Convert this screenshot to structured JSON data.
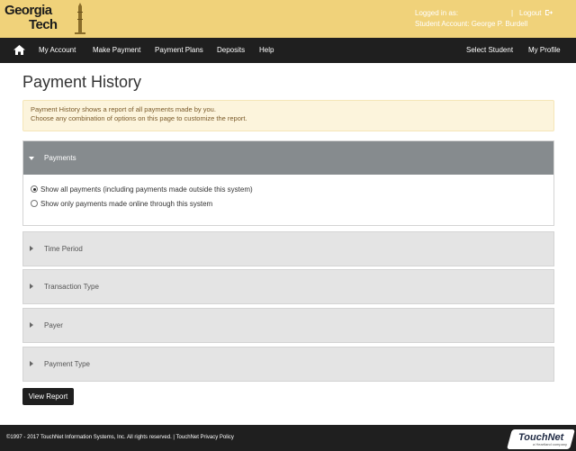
{
  "header": {
    "logo_line1": "Georgia",
    "logo_line2": "Tech",
    "logged_in_label": "Logged in as:",
    "separator": "|",
    "logout_label": "Logout",
    "student_account": "Student Account: George P. Burdell"
  },
  "nav": {
    "items": [
      "My Account",
      "Make Payment",
      "Payment Plans",
      "Deposits",
      "Help"
    ],
    "right_items": [
      "Select Student",
      "My Profile"
    ]
  },
  "page": {
    "title": "Payment History",
    "notice_line1": "Payment History shows a report of all payments made by you.",
    "notice_line2": "Choose any combination of options on this page to customize the report."
  },
  "sections": {
    "payments": {
      "label": "Payments",
      "options": [
        {
          "label": "Show all payments (including payments made outside this system)",
          "checked": true
        },
        {
          "label": "Show only payments made online through this system",
          "checked": false
        }
      ]
    },
    "time_period": {
      "label": "Time Period"
    },
    "transaction_type": {
      "label": "Transaction Type"
    },
    "payer": {
      "label": "Payer"
    },
    "payment_type": {
      "label": "Payment Type"
    }
  },
  "actions": {
    "view_report": "View Report"
  },
  "footer": {
    "copyright": "©1997 - 2017  TouchNet Information Systems, Inc. All rights reserved. | TouchNet Privacy Policy",
    "brand": "TouchNet",
    "brand_sub": "a Heartland company"
  },
  "colors": {
    "header_bg": "#f0d27a",
    "nav_bg": "#1f1f1f",
    "open_section_bg": "#868b8e",
    "closed_section_bg": "#e4e4e4",
    "notice_bg": "#fcf4dc"
  },
  "icons": {
    "home": "home-icon",
    "logout": "logout-icon",
    "logo_tower": "tech-tower-icon"
  }
}
